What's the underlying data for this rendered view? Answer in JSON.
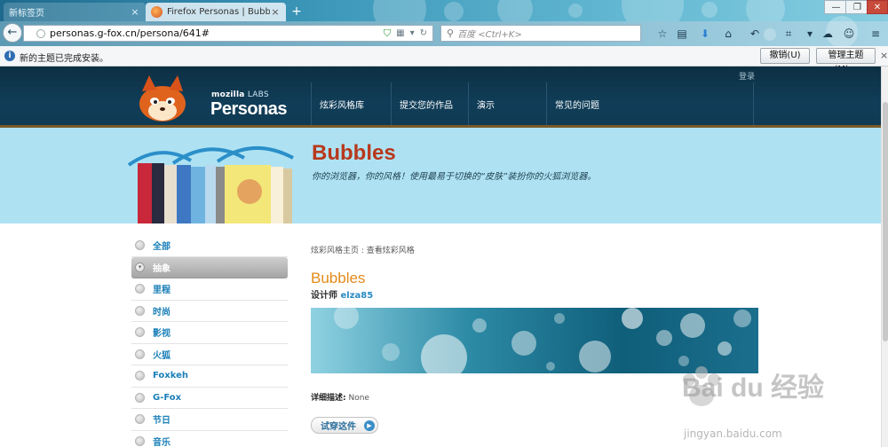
{
  "browser": {
    "tabs": [
      {
        "label": "新标签页",
        "active": false
      },
      {
        "label": "Firefox Personas | Bubbl...",
        "active": true
      }
    ],
    "url": "personas.g-fox.cn/persona/641#",
    "search_placeholder": "百度 <Ctrl+K>",
    "notification": {
      "text": "新的主题已完成安装。",
      "undo_label": "撤销(U)",
      "manage_label": "管理主题(M)..."
    }
  },
  "site": {
    "login": "登录",
    "logo_mozilla": "mozilla",
    "logo_labs": "LABS",
    "logo_name": "Personas",
    "nav": [
      "炫彩风格库",
      "提交您的作品",
      "演示",
      "常见的问题"
    ],
    "banner_title": "Bubbles",
    "banner_subtitle": "你的浏览器，你的风格！使用最易于切换的“皮肤”装扮你的火狐浏览器。"
  },
  "sidebar": {
    "items": [
      {
        "label": "全部",
        "active": false
      },
      {
        "label": "抽象",
        "active": true
      },
      {
        "label": "里程",
        "active": false
      },
      {
        "label": "时尚",
        "active": false
      },
      {
        "label": "影视",
        "active": false
      },
      {
        "label": "火狐",
        "active": false
      },
      {
        "label": "Foxkeh",
        "active": false
      },
      {
        "label": "G-Fox",
        "active": false
      },
      {
        "label": "节日",
        "active": false
      },
      {
        "label": "音乐",
        "active": false
      }
    ]
  },
  "persona": {
    "breadcrumb": "炫彩风格主页 : 查看炫彩风格",
    "title": "Bubbles",
    "designer_label": "设计师",
    "designer_name": "elza85",
    "desc_label": "详细描述:",
    "desc_value": "None",
    "try_label": "试穿这件"
  },
  "watermark": {
    "brand": "Bai du 经验",
    "url": "jingyan.baidu.com"
  },
  "colors": {
    "header_bg": "#0f3a53",
    "banner_bg": "#aee2f2",
    "title_red": "#b8381d",
    "title_orange": "#e48a1a",
    "link_blue": "#1a7fb8"
  }
}
